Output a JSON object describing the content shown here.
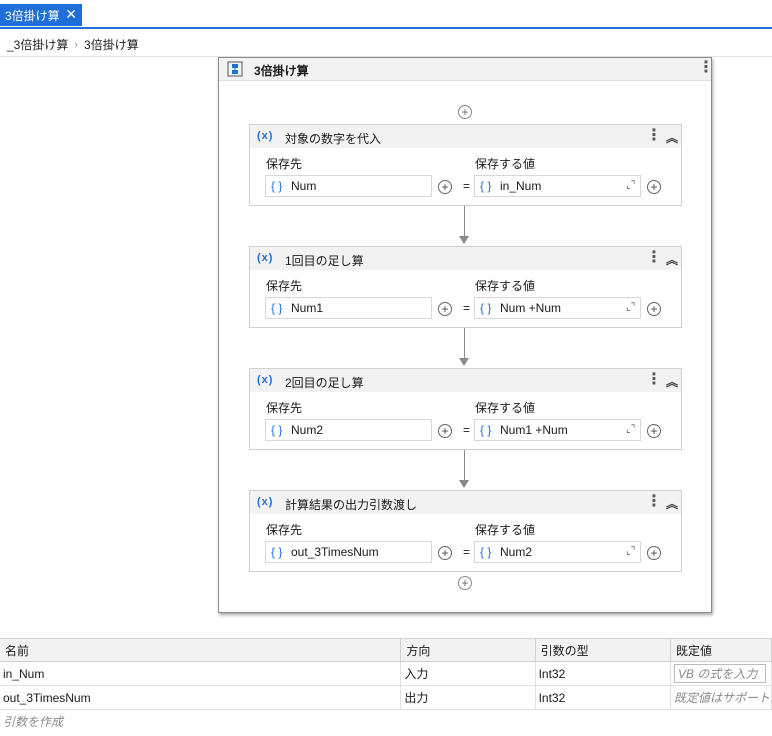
{
  "tab": {
    "title": "3倍掛け算",
    "close_icon": "close-icon"
  },
  "breadcrumb": {
    "items": [
      "_3倍掛け算",
      "3倍掛け算"
    ]
  },
  "sequence": {
    "title": "3倍掛け算",
    "icon": "sequence-icon"
  },
  "labels": {
    "to": "保存先",
    "value": "保存する値",
    "equals": "="
  },
  "activities": [
    {
      "title": "対象の数字を代入",
      "to": "Num",
      "value": "in_Num"
    },
    {
      "title": "1回目の足し算",
      "to": "Num1",
      "value": "Num +Num"
    },
    {
      "title": "2回目の足し算",
      "to": "Num2",
      "value": "Num1 +Num"
    },
    {
      "title": "計算結果の出力引数渡し",
      "to": "out_3TimesNum",
      "value": "Num2"
    }
  ],
  "arguments": {
    "headers": [
      "名前",
      "方向",
      "引数の型",
      "既定値"
    ],
    "rows": [
      {
        "name": "in_Num",
        "direction": "入力",
        "type": "Int32",
        "default": "VB の式を入力"
      },
      {
        "name": "out_3TimesNum",
        "direction": "出力",
        "type": "Int32",
        "default": "既定値はサポートされ"
      }
    ],
    "create": "引数を作成"
  },
  "colors": {
    "accent": "#1e6fd9",
    "header_bg": "#f2f2f2",
    "border": "#d0d0d0"
  }
}
